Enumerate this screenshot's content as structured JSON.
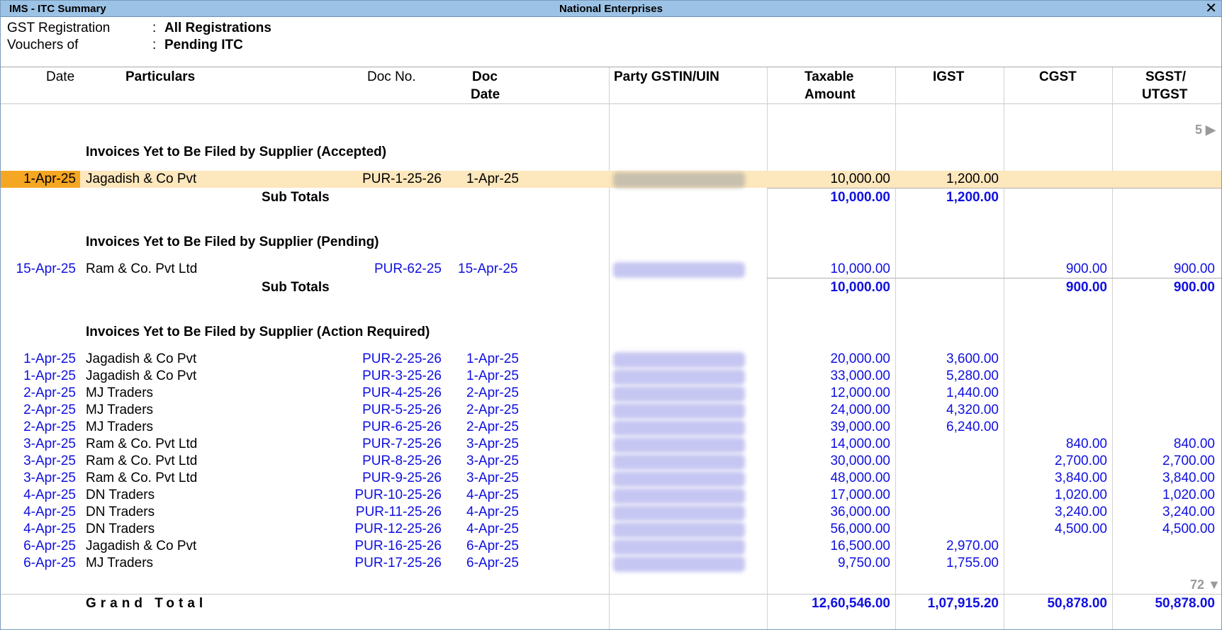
{
  "window": {
    "title": "IMS - ITC Summary",
    "company": "National Enterprises",
    "close_label": "✕"
  },
  "filters": {
    "gst_label": "GST Registration",
    "gst_value": "All Registrations",
    "vouchers_label": "Vouchers of",
    "vouchers_value": "Pending ITC",
    "colon": ":"
  },
  "columns": {
    "date": "Date",
    "particulars": "Particulars",
    "doc_no": "Doc No.",
    "doc_date_1": "Doc",
    "doc_date_2": "Date",
    "gstin": "Party GSTIN/UIN",
    "taxable_1": "Taxable",
    "taxable_2": "Amount",
    "igst": "IGST",
    "cgst": "CGST",
    "sgst_1": "SGST/",
    "sgst_2": "UTGST"
  },
  "scroll": {
    "top_count": "5 ▶",
    "bottom_count": "72 ▼"
  },
  "sections": [
    {
      "title": "Invoices Yet to Be Filed by Supplier (Accepted)",
      "rows": [
        {
          "date": "1-Apr-25",
          "party": "Jagadish & Co Pvt",
          "doc_no": "PUR-1-25-26",
          "doc_date": "1-Apr-25",
          "taxable": "10,000.00",
          "igst": "1,200.00",
          "cgst": "",
          "sgst": ""
        }
      ],
      "subtotal": {
        "label": "Sub Totals",
        "taxable": "10,000.00",
        "igst": "1,200.00",
        "cgst": "",
        "sgst": ""
      }
    },
    {
      "title": "Invoices Yet to Be Filed by Supplier (Pending)",
      "rows": [
        {
          "date": "15-Apr-25",
          "party": "Ram & Co. Pvt Ltd",
          "doc_no": "PUR-62-25",
          "doc_date": "15-Apr-25",
          "taxable": "10,000.00",
          "igst": "",
          "cgst": "900.00",
          "sgst": "900.00"
        }
      ],
      "subtotal": {
        "label": "Sub Totals",
        "taxable": "10,000.00",
        "igst": "",
        "cgst": "900.00",
        "sgst": "900.00"
      }
    },
    {
      "title": "Invoices Yet to Be Filed by Supplier (Action Required)",
      "rows": [
        {
          "date": "1-Apr-25",
          "party": "Jagadish & Co Pvt",
          "doc_no": "PUR-2-25-26",
          "doc_date": "1-Apr-25",
          "taxable": "20,000.00",
          "igst": "3,600.00",
          "cgst": "",
          "sgst": ""
        },
        {
          "date": "1-Apr-25",
          "party": "Jagadish & Co Pvt",
          "doc_no": "PUR-3-25-26",
          "doc_date": "1-Apr-25",
          "taxable": "33,000.00",
          "igst": "5,280.00",
          "cgst": "",
          "sgst": ""
        },
        {
          "date": "2-Apr-25",
          "party": "MJ Traders",
          "doc_no": "PUR-4-25-26",
          "doc_date": "2-Apr-25",
          "taxable": "12,000.00",
          "igst": "1,440.00",
          "cgst": "",
          "sgst": ""
        },
        {
          "date": "2-Apr-25",
          "party": "MJ Traders",
          "doc_no": "PUR-5-25-26",
          "doc_date": "2-Apr-25",
          "taxable": "24,000.00",
          "igst": "4,320.00",
          "cgst": "",
          "sgst": ""
        },
        {
          "date": "2-Apr-25",
          "party": "MJ Traders",
          "doc_no": "PUR-6-25-26",
          "doc_date": "2-Apr-25",
          "taxable": "39,000.00",
          "igst": "6,240.00",
          "cgst": "",
          "sgst": ""
        },
        {
          "date": "3-Apr-25",
          "party": "Ram & Co. Pvt Ltd",
          "doc_no": "PUR-7-25-26",
          "doc_date": "3-Apr-25",
          "taxable": "14,000.00",
          "igst": "",
          "cgst": "840.00",
          "sgst": "840.00"
        },
        {
          "date": "3-Apr-25",
          "party": "Ram & Co. Pvt Ltd",
          "doc_no": "PUR-8-25-26",
          "doc_date": "3-Apr-25",
          "taxable": "30,000.00",
          "igst": "",
          "cgst": "2,700.00",
          "sgst": "2,700.00"
        },
        {
          "date": "3-Apr-25",
          "party": "Ram & Co. Pvt Ltd",
          "doc_no": "PUR-9-25-26",
          "doc_date": "3-Apr-25",
          "taxable": "48,000.00",
          "igst": "",
          "cgst": "3,840.00",
          "sgst": "3,840.00"
        },
        {
          "date": "4-Apr-25",
          "party": "DN Traders",
          "doc_no": "PUR-10-25-26",
          "doc_date": "4-Apr-25",
          "taxable": "17,000.00",
          "igst": "",
          "cgst": "1,020.00",
          "sgst": "1,020.00"
        },
        {
          "date": "4-Apr-25",
          "party": "DN Traders",
          "doc_no": "PUR-11-25-26",
          "doc_date": "4-Apr-25",
          "taxable": "36,000.00",
          "igst": "",
          "cgst": "3,240.00",
          "sgst": "3,240.00"
        },
        {
          "date": "4-Apr-25",
          "party": "DN Traders",
          "doc_no": "PUR-12-25-26",
          "doc_date": "4-Apr-25",
          "taxable": "56,000.00",
          "igst": "",
          "cgst": "4,500.00",
          "sgst": "4,500.00"
        },
        {
          "date": "6-Apr-25",
          "party": "Jagadish & Co Pvt",
          "doc_no": "PUR-16-25-26",
          "doc_date": "6-Apr-25",
          "taxable": "16,500.00",
          "igst": "2,970.00",
          "cgst": "",
          "sgst": ""
        },
        {
          "date": "6-Apr-25",
          "party": "MJ Traders",
          "doc_no": "PUR-17-25-26",
          "doc_date": "6-Apr-25",
          "taxable": "9,750.00",
          "igst": "1,755.00",
          "cgst": "",
          "sgst": ""
        }
      ]
    }
  ],
  "grand_total": {
    "label": "Grand Total",
    "taxable": "12,60,546.00",
    "igst": "1,07,915.20",
    "cgst": "50,878.00",
    "sgst": "50,878.00"
  },
  "colors": {
    "accent_blue": "#1010e0",
    "titlebar": "#9cc3e6",
    "row_highlight": "#fde7bd",
    "cursor": "#f5a623"
  }
}
